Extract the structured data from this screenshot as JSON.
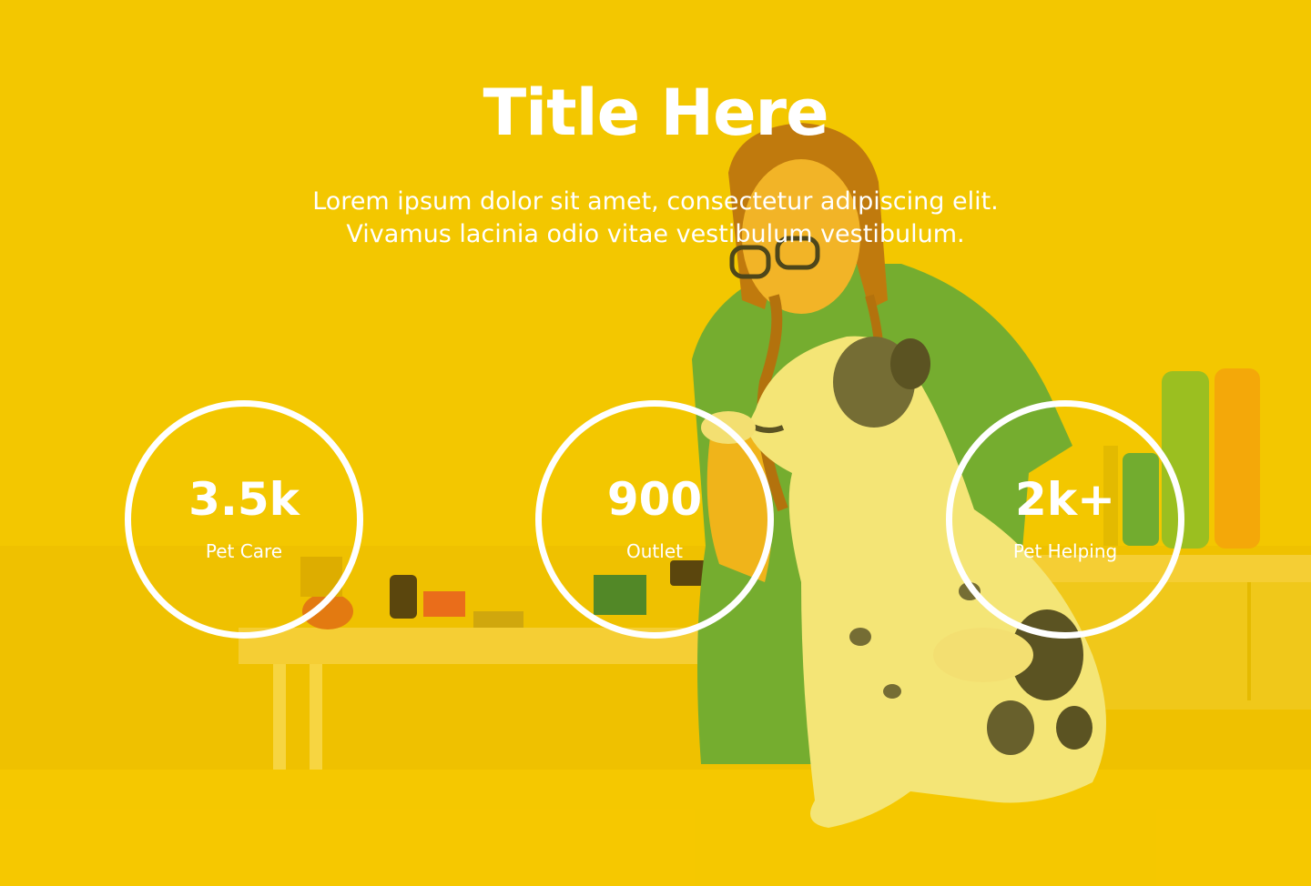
{
  "hero": {
    "title": "Title Here",
    "subtitle_lines": [
      "Lorem ipsum dolor sit amet, consectetur adipiscing elit.",
      "Vivamus lacinia odio vitae vestibulum vestibulum."
    ]
  },
  "stats": [
    {
      "value": "3.5k",
      "label": "Pet Care"
    },
    {
      "value": "900",
      "label": "Outlet"
    },
    {
      "value": "2k+",
      "label": "Pet Helping"
    }
  ],
  "colors": {
    "background": "#f0c400",
    "text": "#ffffff",
    "ring": "#ffffff",
    "scrubs": "#5aa83a"
  }
}
